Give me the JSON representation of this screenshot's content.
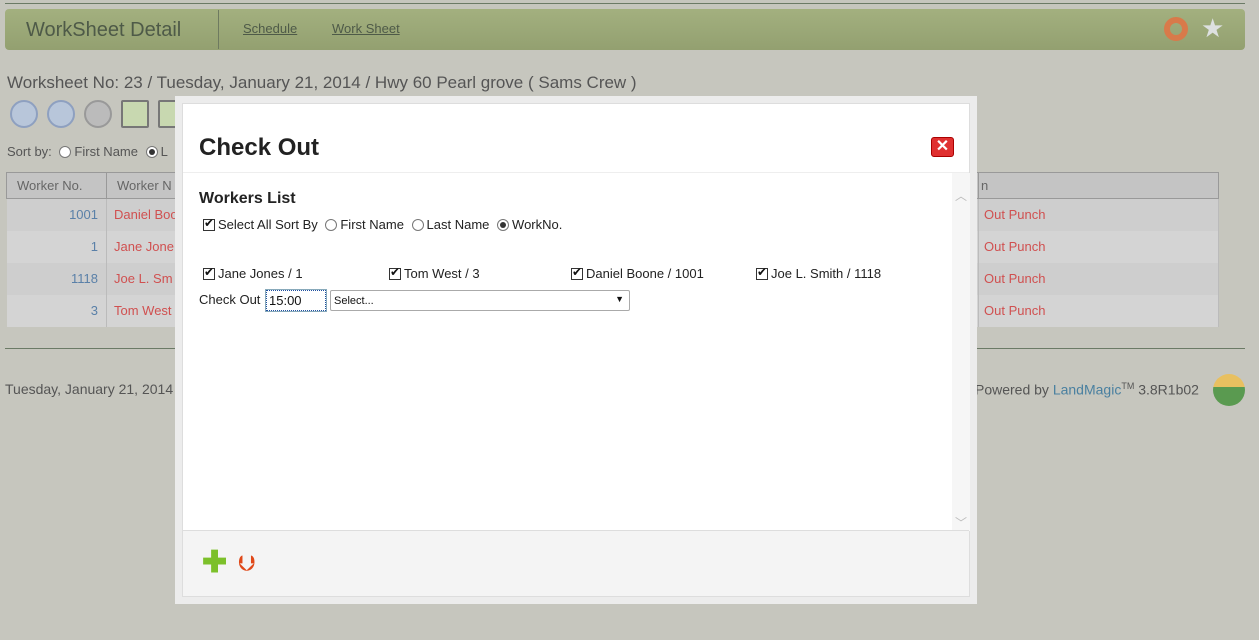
{
  "header": {
    "title": "WorkSheet Detail",
    "nav": [
      "Schedule",
      "Work Sheet"
    ]
  },
  "worksheet_info": "Worksheet No: 23 / Tuesday, January 21, 2014 / Hwy 60 Pearl grove ( Sams Crew )",
  "sort": {
    "label": "Sort by:",
    "first_name": "First Name",
    "last_partial": "L"
  },
  "table": {
    "headers": [
      "Worker No.",
      "Worker N",
      "n"
    ],
    "rows": [
      {
        "no": "1001",
        "name": "Daniel Boo",
        "action": "Out Punch"
      },
      {
        "no": "1",
        "name": "Jane Jone",
        "action": "Out Punch"
      },
      {
        "no": "1118",
        "name": "Joe L. Sm",
        "action": "Out Punch"
      },
      {
        "no": "3",
        "name": "Tom West",
        "action": "Out Punch"
      }
    ]
  },
  "footer": {
    "date": "Tuesday, January 21, 2014",
    "powered": "Powered by",
    "brand": "LandMagic",
    "tm": "TM",
    "version": "3.8R1b02"
  },
  "modal": {
    "title": "Check Out",
    "close": "✕",
    "workers_list": "Workers List",
    "select_all": "Select All",
    "sort_by": "Sort By",
    "sort_options": [
      "First Name",
      "Last Name",
      "WorkNo."
    ],
    "sort_selected": "WorkNo.",
    "workers": [
      "Jane Jones / 1",
      "Tom West / 3",
      "Daniel Boone / 1001",
      "Joe L. Smith / 1118"
    ],
    "checkout_label": "Check Out",
    "checkout_time": "15:00",
    "select_placeholder": "Select..."
  },
  "colors": {
    "header": "#9aa776",
    "link_red": "#d05050",
    "link_blue": "#5a80a8"
  }
}
